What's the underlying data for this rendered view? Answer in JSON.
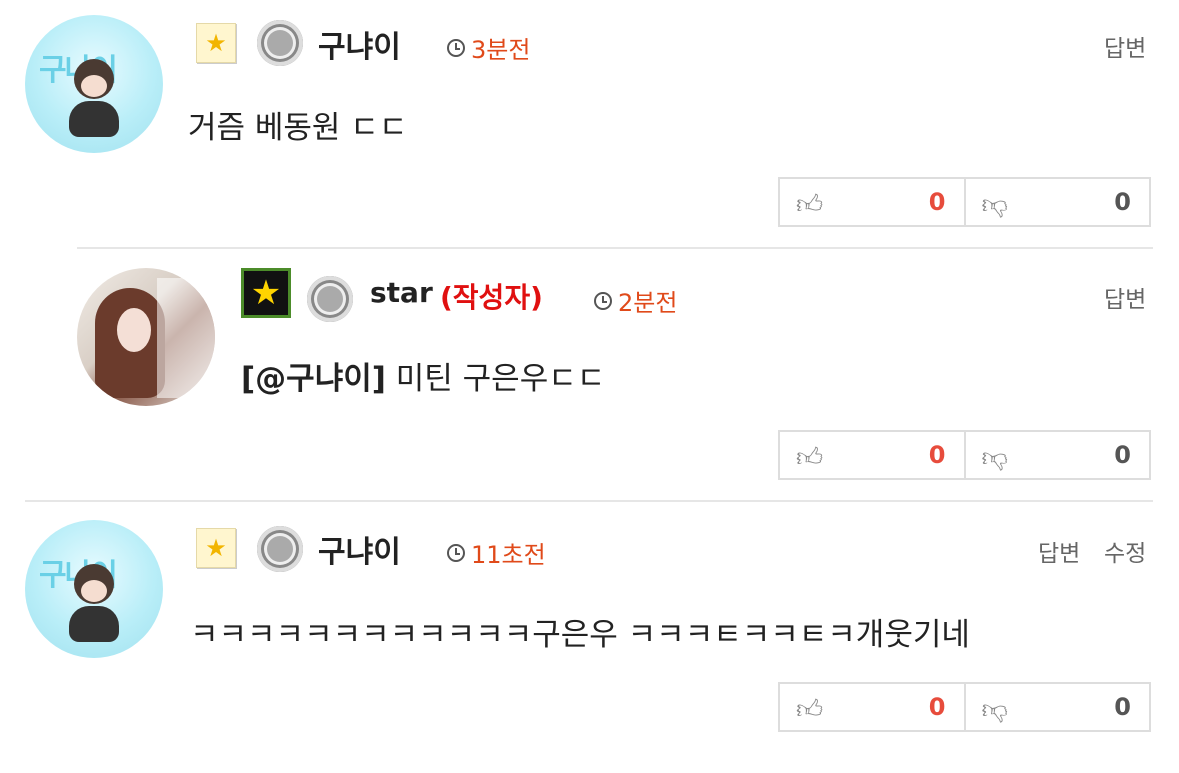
{
  "comments": [
    {
      "nickname": "구냐이",
      "author_tag": "",
      "time": "3분전",
      "actions": [
        "답변"
      ],
      "text": "거즘 베동원 ㄷㄷ",
      "mention": "",
      "likes": "0",
      "dislikes": "0",
      "level_icon": "star-icon",
      "avatar": "cartoon-avatar"
    },
    {
      "nickname": "star",
      "author_tag": "(작성자)",
      "time": "2분전",
      "actions": [
        "답변"
      ],
      "mention": "[@구냐이]",
      "text": "미틴 구은우ㄷㄷ",
      "likes": "0",
      "dislikes": "0",
      "level_icon": "star-icon",
      "avatar": "photo-avatar"
    },
    {
      "nickname": "구냐이",
      "author_tag": "",
      "time": "11초전",
      "actions": [
        "답변",
        "수정"
      ],
      "text": "ㅋㅋㅋㅋㅋㅋㅋㅋㅋㅋㅋㅋ구은우 ㅋㅋㅋㅌㅋㅋㅌㅋ개웃기네",
      "mention": "",
      "likes": "0",
      "dislikes": "0",
      "level_icon": "star-icon",
      "avatar": "cartoon-avatar"
    }
  ],
  "colors": {
    "time": "#e04a1a",
    "author_tag": "#e01010",
    "like_count": "#e74c3c"
  }
}
